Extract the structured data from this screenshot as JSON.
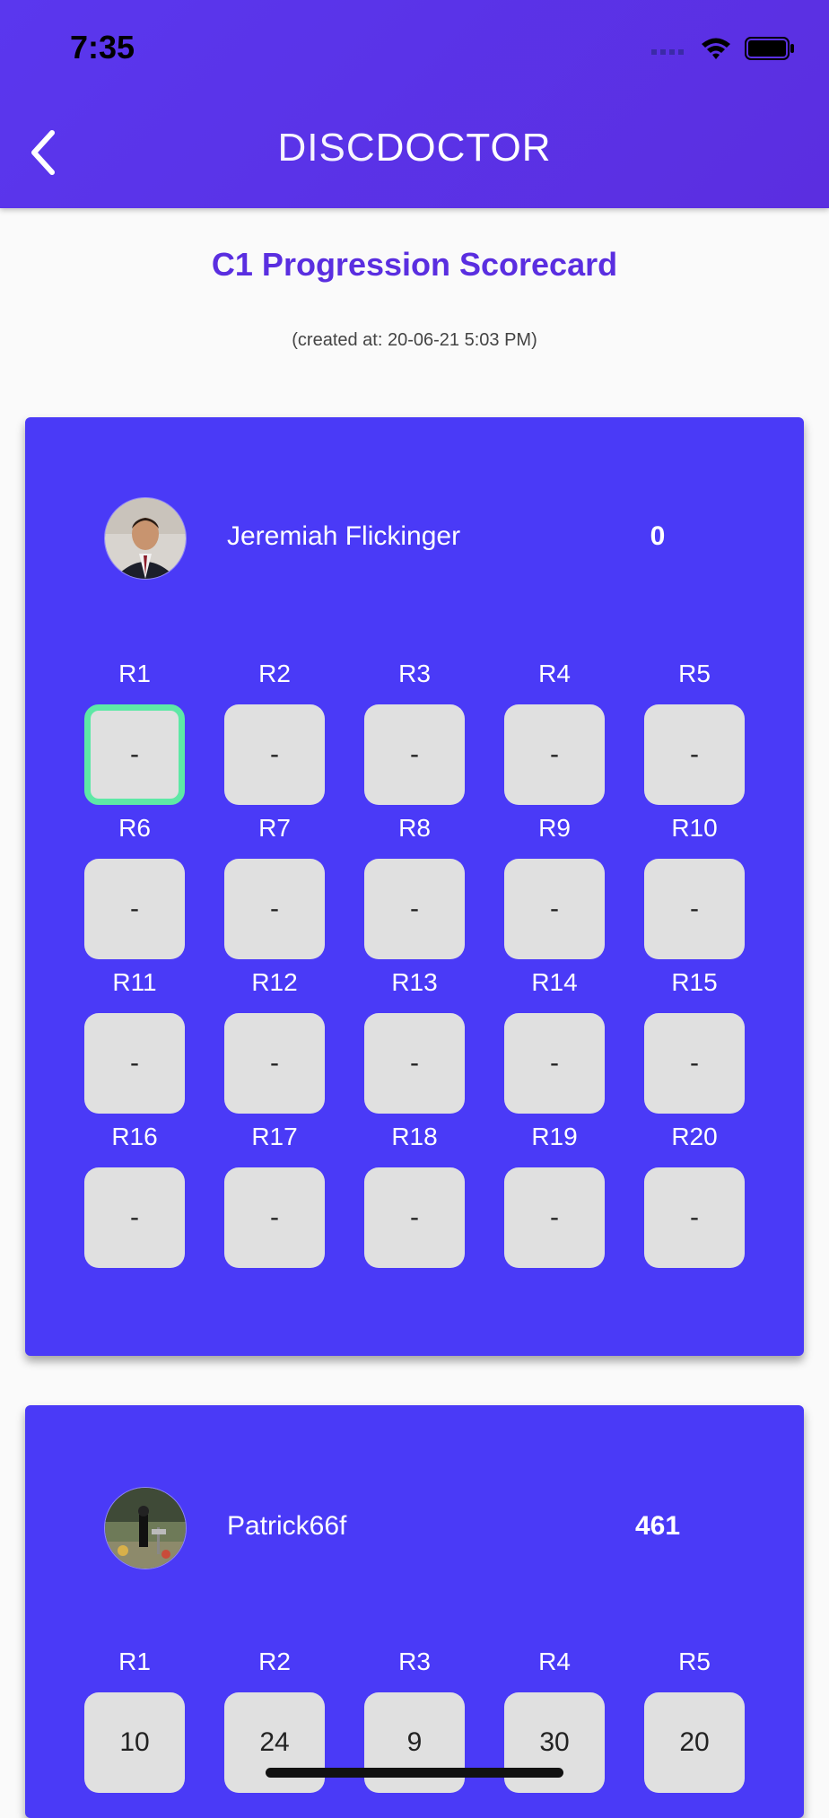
{
  "status_bar": {
    "time": "7:35"
  },
  "header": {
    "app_title_light": "DISC",
    "app_title_bold": "DOCTOR"
  },
  "page": {
    "title": "C1 Progression Scorecard",
    "created_at": "(created at: 20-06-21 5:03 PM)"
  },
  "colors": {
    "header": "#5a37ee",
    "card": "#4a3af7",
    "title": "#5a2ee0",
    "active_border": "#5ee8a6",
    "box": "#e0e0e0"
  },
  "players": [
    {
      "name": "Jeremiah Flickinger",
      "total": "0",
      "rounds": [
        {
          "label": "R1",
          "value": "-"
        },
        {
          "label": "R2",
          "value": "-"
        },
        {
          "label": "R3",
          "value": "-"
        },
        {
          "label": "R4",
          "value": "-"
        },
        {
          "label": "R5",
          "value": "-"
        },
        {
          "label": "R6",
          "value": "-"
        },
        {
          "label": "R7",
          "value": "-"
        },
        {
          "label": "R8",
          "value": "-"
        },
        {
          "label": "R9",
          "value": "-"
        },
        {
          "label": "R10",
          "value": "-"
        },
        {
          "label": "R11",
          "value": "-"
        },
        {
          "label": "R12",
          "value": "-"
        },
        {
          "label": "R13",
          "value": "-"
        },
        {
          "label": "R14",
          "value": "-"
        },
        {
          "label": "R15",
          "value": "-"
        },
        {
          "label": "R16",
          "value": "-"
        },
        {
          "label": "R17",
          "value": "-"
        },
        {
          "label": "R18",
          "value": "-"
        },
        {
          "label": "R19",
          "value": "-"
        },
        {
          "label": "R20",
          "value": "-"
        }
      ]
    },
    {
      "name": "Patrick66f",
      "total": "461",
      "rounds": [
        {
          "label": "R1",
          "value": "10"
        },
        {
          "label": "R2",
          "value": "24"
        },
        {
          "label": "R3",
          "value": "9"
        },
        {
          "label": "R4",
          "value": "30"
        },
        {
          "label": "R5",
          "value": "20"
        }
      ]
    }
  ]
}
